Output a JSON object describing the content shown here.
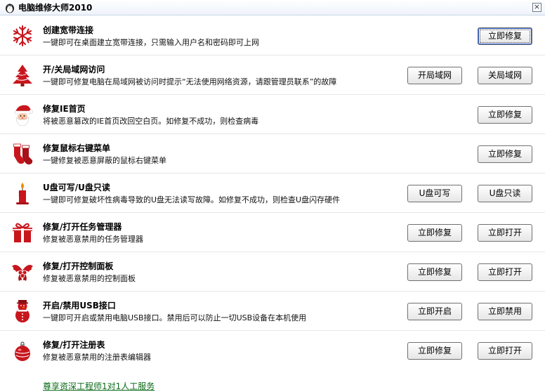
{
  "window": {
    "title": "电脑维修大师2010",
    "close_label": "×"
  },
  "items": [
    {
      "id": "broadband",
      "icon": "snowflake-icon",
      "name": "创建宽带连接",
      "desc": "一键即可在桌面建立宽带连接，只需输入用户名和密码即可上网",
      "buttons": [
        {
          "label": "立即修复"
        }
      ]
    },
    {
      "id": "lan",
      "icon": "christmas-tree-icon",
      "name": "开/关局域网访问",
      "desc": "一键即可修复电脑在局域网被访问时提示“无法使用网络资源，请跟管理员联系”的故障",
      "buttons": [
        {
          "label": "开局域网"
        },
        {
          "label": "关局域网"
        }
      ]
    },
    {
      "id": "ie-home",
      "icon": "santa-icon",
      "name": "修复IE首页",
      "desc": "将被恶意篡改的IE首页改回空白页。如修复不成功，则检查病毒",
      "buttons": [
        {
          "label": "立即修复"
        }
      ]
    },
    {
      "id": "context-menu",
      "icon": "stocking-icon",
      "name": "修复鼠标右键菜单",
      "desc": "一键修复被恶意屏蔽的鼠标右键菜单",
      "buttons": [
        {
          "label": "立即修复"
        }
      ]
    },
    {
      "id": "usb-rw",
      "icon": "candle-icon",
      "name": "U盘可写/U盘只读",
      "desc": "一键即可修复破坏性病毒导致的U盘无法读写故障。如修复不成功，则检查U盘闪存硬件",
      "buttons": [
        {
          "label": "U盘可写"
        },
        {
          "label": "U盘只读"
        }
      ]
    },
    {
      "id": "task-manager",
      "icon": "gift-box-icon",
      "name": "修复/打开任务管理器",
      "desc": "修复被恶意禁用的任务管理器",
      "buttons": [
        {
          "label": "立即修复"
        },
        {
          "label": "立即打开"
        }
      ]
    },
    {
      "id": "control-panel",
      "icon": "holly-icon",
      "name": "修复/打开控制面板",
      "desc": "修复被恶意禁用的控制面板",
      "buttons": [
        {
          "label": "立即修复"
        },
        {
          "label": "立即打开"
        }
      ]
    },
    {
      "id": "usb-port",
      "icon": "snowman-icon",
      "name": "开启/禁用USB接口",
      "desc": "一键即可开启或禁用电脑USB接口。禁用后可以防止一切USB设备在本机使用",
      "buttons": [
        {
          "label": "立即开启"
        },
        {
          "label": "立即禁用"
        }
      ]
    },
    {
      "id": "registry",
      "icon": "ornament-ball-icon",
      "name": "修复/打开注册表",
      "desc": "修复被恶意禁用的注册表编辑器",
      "buttons": [
        {
          "label": "立即修复"
        },
        {
          "label": "立即打开"
        }
      ]
    }
  ],
  "footer": {
    "link_text": "尊享资深工程师1对1人工服务"
  },
  "colors": {
    "icon_red": "#c8161d",
    "link_green": "#0a6b17",
    "focus_blue": "#2b58c7"
  }
}
